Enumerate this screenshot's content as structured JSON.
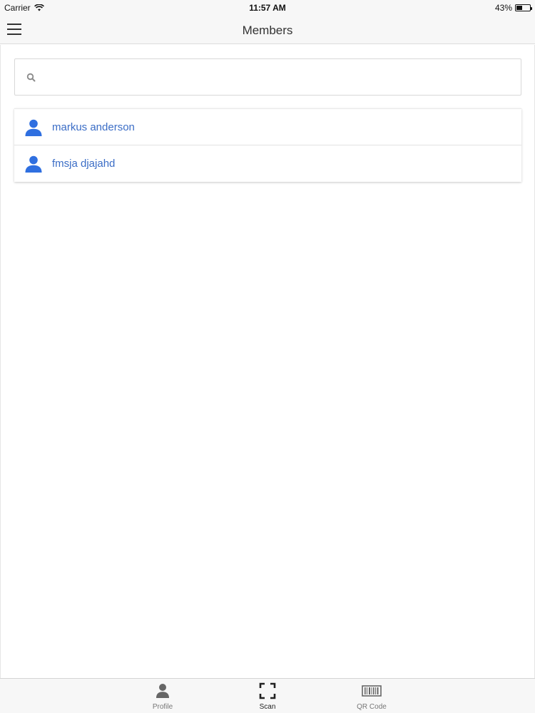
{
  "status_bar": {
    "carrier": "Carrier",
    "time": "11:57 AM",
    "battery_percent": "43%",
    "battery_level": 0.43
  },
  "nav": {
    "title": "Members",
    "menu_icon": "hamburger-icon"
  },
  "search": {
    "value": "",
    "placeholder": "",
    "icon": "search-icon"
  },
  "members": [
    {
      "name": "markus anderson",
      "icon": "person-icon"
    },
    {
      "name": "fmsja djajahd",
      "icon": "person-icon"
    }
  ],
  "tabs": [
    {
      "label": "Profile",
      "icon": "person-icon"
    },
    {
      "label": "Scan",
      "icon": "scan-icon"
    },
    {
      "label": "QR Code",
      "icon": "barcode-icon"
    }
  ],
  "colors": {
    "accent": "#3b6dc6",
    "person_icon": "#2f6fe0"
  }
}
